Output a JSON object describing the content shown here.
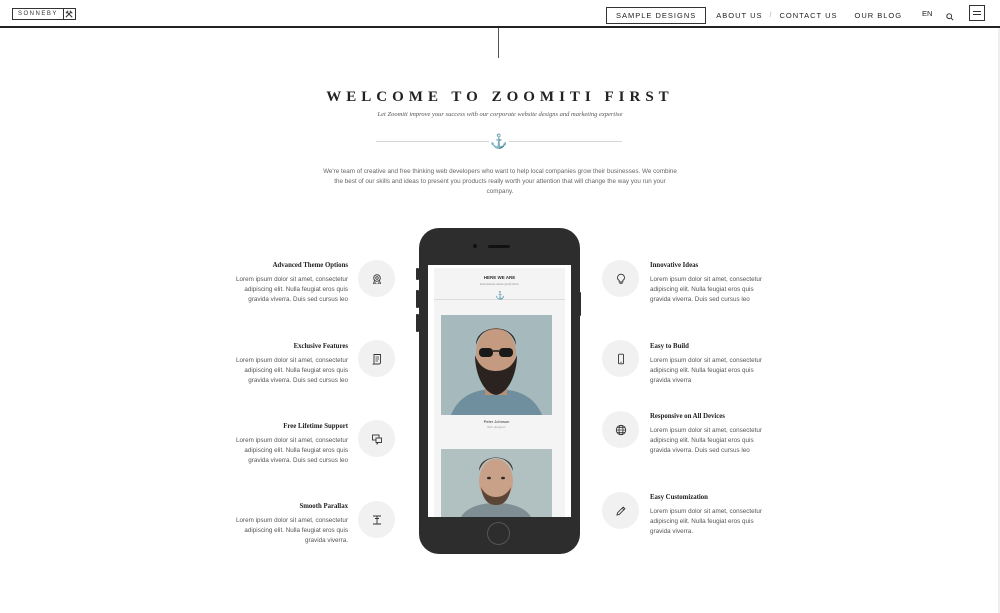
{
  "header": {
    "logo_text": "SONNEBY",
    "logo_icon": "hammers-icon",
    "nav": [
      {
        "label": "SAMPLE DESIGNS"
      },
      {
        "label": "ABOUT US"
      },
      {
        "label": "CONTACT US"
      },
      {
        "label": "OUR BLOG"
      }
    ],
    "nav_separator": "/",
    "lang": "EN"
  },
  "intro": {
    "title": "WELCOME TO ZOOMITI FIRST",
    "subtitle": "Let Zoomiti improve your success with our corporate website designs and marketing expertise",
    "text": "We're team of creative and free thinking web developers who want to help local companies grow their businesses. We combine the best of our skills and ideas to present you products really worth your attention that will change the way you run your company."
  },
  "features_left": [
    {
      "title": "Advanced Theme Options",
      "text": "Lorem ipsum dolor sit amet, consectetur adipiscing elit. Nulla feugiat eros quis gravida viverra. Duis sed cursus leo",
      "icon": "award-icon"
    },
    {
      "title": "Exclusive Features",
      "text": "Lorem ipsum dolor sit amet, consectetur adipiscing elit. Nulla feugiat eros quis gravida viverra. Duis sed cursus leo",
      "icon": "scroll-icon"
    },
    {
      "title": "Free Lifetime Support",
      "text": "Lorem ipsum dolor sit amet, consectetur adipiscing elit. Nulla feugiat eros quis gravida viverra. Duis sed cursus leo",
      "icon": "chat-icon"
    },
    {
      "title": "Smooth Parallax",
      "text": "Lorem ipsum dolor sit amet, consectetur adipiscing elit. Nulla feugiat eros quis gravida viverra.",
      "icon": "text-cursor-icon"
    }
  ],
  "features_right": [
    {
      "title": "Innovative Ideas",
      "text": "Lorem ipsum dolor sit amet, consectetur adipiscing elit. Nulla feugiat eros quis gravida viverra. Duis sed cursus leo",
      "icon": "lightbulb-icon"
    },
    {
      "title": "Easy to Build",
      "text": "Lorem ipsum dolor sit amet, consectetur adipiscing elit. Nulla feugiat eros quis gravida viverra",
      "icon": "mobile-icon"
    },
    {
      "title": "Responsive on All Devices",
      "text": "Lorem ipsum dolor sit amet, consectetur adipiscing elit. Nulla feugiat eros quis gravida viverra. Duis sed cursus leo",
      "icon": "globe-icon"
    },
    {
      "title": "Easy Customization",
      "text": "Lorem ipsum dolor sit amet, consectetur adipiscing elit. Nulla feugiat eros quis gravida viverra.",
      "icon": "pencil-icon"
    }
  ],
  "phone_screen": {
    "title": "HERE WE ARE",
    "subtitle": "Passionate ideas perfection",
    "person_name": "Peter Johnson",
    "person_role": "Web designer"
  }
}
